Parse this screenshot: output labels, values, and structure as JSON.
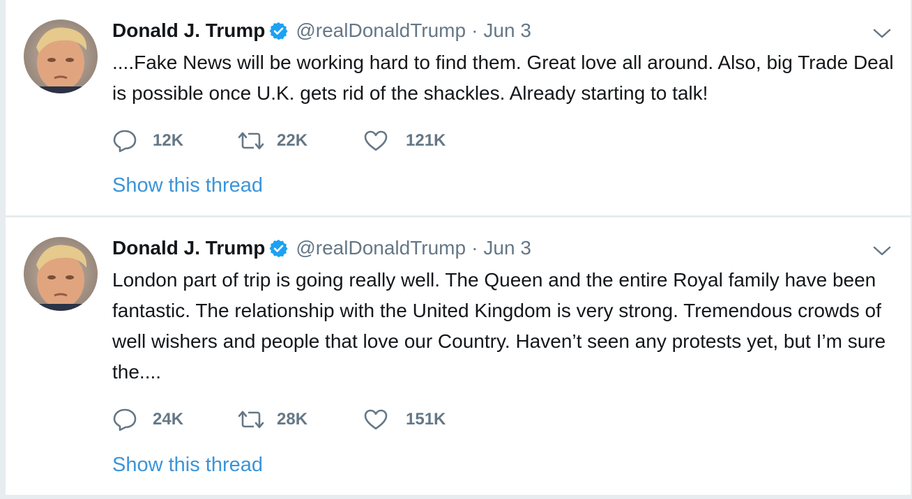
{
  "tweets": [
    {
      "author_name": "Donald J. Trump",
      "handle": "@realDonaldTrump",
      "separator": "·",
      "date": "Jun 3",
      "text": "....Fake News will be working hard to find them. Great love all around. Also, big Trade Deal is possible once U.K. gets rid of the shackles. Already starting to talk!",
      "replies": "12K",
      "retweets": "22K",
      "likes": "121K",
      "thread_link": "Show this thread"
    },
    {
      "author_name": "Donald J. Trump",
      "handle": "@realDonaldTrump",
      "separator": "·",
      "date": "Jun 3",
      "text": "London part of trip is going really well. The Queen and the entire Royal family have been fantastic. The relationship with the United Kingdom is very strong. Tremendous crowds of well wishers and people that love our Country. Haven’t seen any protests yet, but I’m sure the....",
      "replies": "24K",
      "retweets": "28K",
      "likes": "151K",
      "thread_link": "Show this thread"
    }
  ],
  "icons": {
    "verified": "verified-badge-icon",
    "caret": "chevron-down-icon",
    "reply": "reply-icon",
    "retweet": "retweet-icon",
    "like": "heart-icon"
  },
  "colors": {
    "background": "#e6ecf0",
    "card": "#ffffff",
    "text": "#14171a",
    "secondary": "#657786",
    "link": "#3b94d9",
    "verified": "#1da1f2"
  }
}
